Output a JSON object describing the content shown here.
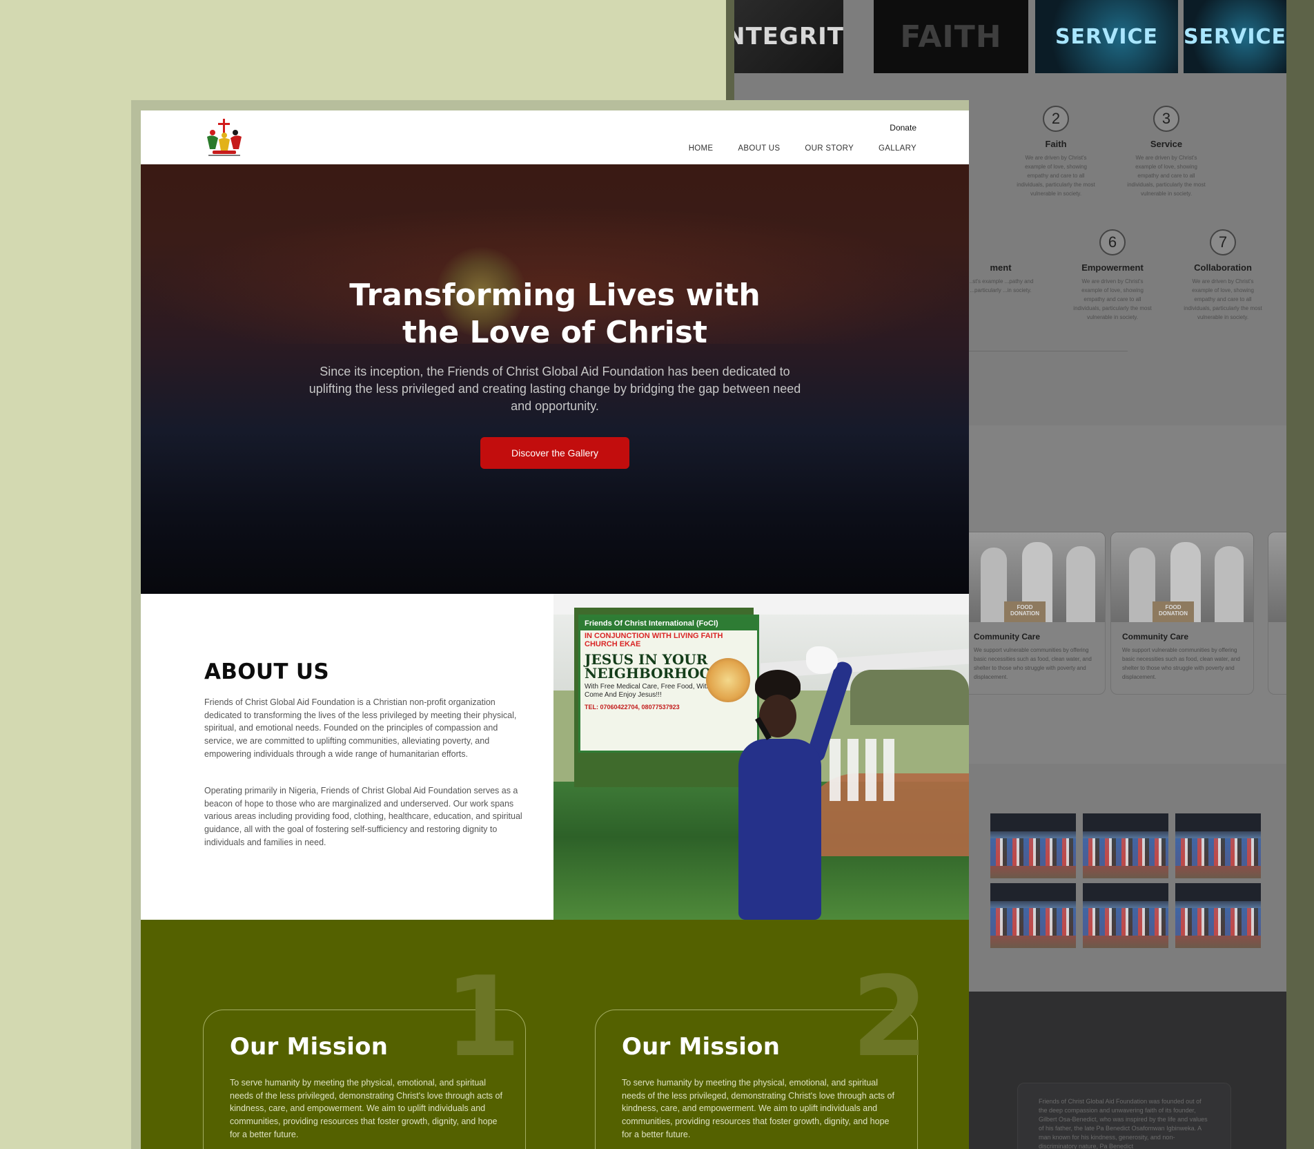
{
  "background_mockup": {
    "tiles": [
      "INTEGRITY",
      "FAITH",
      "SERVICE",
      "SERVICE"
    ],
    "values_row1": [
      {
        "number": "2",
        "name": "Faith",
        "desc": "We are driven by Christ's example of love, showing empathy and care to all individuals, particularly the most vulnerable in society."
      },
      {
        "number": "3",
        "name": "Service",
        "desc": "We are driven by Christ's example of love, showing empathy and care to all individuals, particularly the most vulnerable in society."
      }
    ],
    "values_row2": [
      {
        "number": "",
        "name": "ment",
        "desc": "...st's example ...pathy and ...particularly ...in society."
      },
      {
        "number": "6",
        "name": "Empowerment",
        "desc": "We are driven by Christ's example of love, showing empathy and care to all individuals, particularly the most vulnerable in society."
      },
      {
        "number": "7",
        "name": "Collaboration",
        "desc": "We are driven by Christ's example of love, showing empathy and care to all individuals, particularly the most vulnerable in society."
      }
    ],
    "cards": [
      {
        "title": "Community Care",
        "desc": "We support vulnerable communities by offering basic necessities such as food, clean water, and shelter to those who struggle with poverty and displacement.",
        "box": "FOOD DONATION"
      },
      {
        "title": "Community Care",
        "desc": "We support vulnerable communities by offering basic necessities such as food, clean water, and shelter to those who struggle with poverty and displacement.",
        "box": "FOOD DONATION"
      }
    ],
    "footer_text": "Friends of Christ Global Aid Foundation was founded out of the deep compassion and unwavering faith of its founder, Gilbert Osa-Benedict, who was inspired by the life and values of his father, the late Pa Benedict Osafomwan Igbinweka. A man known for his kindness, generosity, and non-discriminatory nature, Pa Benedict"
  },
  "header": {
    "donate_label": "Donate",
    "nav": [
      "HOME",
      "ABOUT US",
      "OUR STORY",
      "GALLARY"
    ]
  },
  "hero": {
    "title_line1": "Transforming Lives with",
    "title_line2": "the Love of Christ",
    "subtitle": "Since its inception, the Friends of Christ Global Aid Foundation has been dedicated to uplifting the less privileged and creating lasting change by bridging the gap between need and opportunity.",
    "cta_label": "Discover the Gallery"
  },
  "about": {
    "title": "ABOUT US",
    "paragraph1": "Friends of Christ Global Aid Foundation is a Christian non-profit organization dedicated to transforming the lives of the less privileged by meeting their physical, spiritual, and emotional needs. Founded on the principles of compassion and service, we are committed to uplifting communities, alleviating poverty, and empowering individuals through a wide range of humanitarian efforts.",
    "paragraph2": "Operating primarily in Nigeria, Friends of Christ Global Aid Foundation serves as a beacon of hope to those who are marginalized and underserved. Our work spans various areas including providing food, clothing, healthcare, education, and spiritual guidance, all with the goal of fostering self-sufficiency and restoring dignity to individuals and families in need.",
    "photo_banner": {
      "head": "Friends Of Christ International (FoCI)",
      "sub": "IN CONJUNCTION WITH LIVING FAITH CHURCH EKAE",
      "title": "JESUS IN YOUR NEIGHBORHOOD",
      "small": "With Free Medical Care, Free Food, With Live Music. Come And Enjoy Jesus!!!",
      "tel": "TEL: 07060422704, 08077537923"
    }
  },
  "mission": {
    "cards": [
      {
        "number": "1",
        "title": "Our Mission",
        "text": "To serve humanity by meeting the physical, emotional, and spiritual needs of the less privileged, demonstrating Christ's love through acts of kindness, care, and empowerment. We aim to uplift individuals and communities, providing resources that foster growth, dignity, and hope for a better future."
      },
      {
        "number": "2",
        "title": "Our Mission",
        "text": "To serve humanity by meeting the physical, emotional, and spiritual needs of the less privileged, demonstrating Christ's love through acts of kindness, care, and empowerment. We aim to uplift individuals and communities, providing resources that foster growth, dignity, and hope for a better future."
      }
    ]
  },
  "colors": {
    "page_bg": "#d3d9b1",
    "accent_red": "#c20d0d",
    "mission_green": "#546100"
  }
}
